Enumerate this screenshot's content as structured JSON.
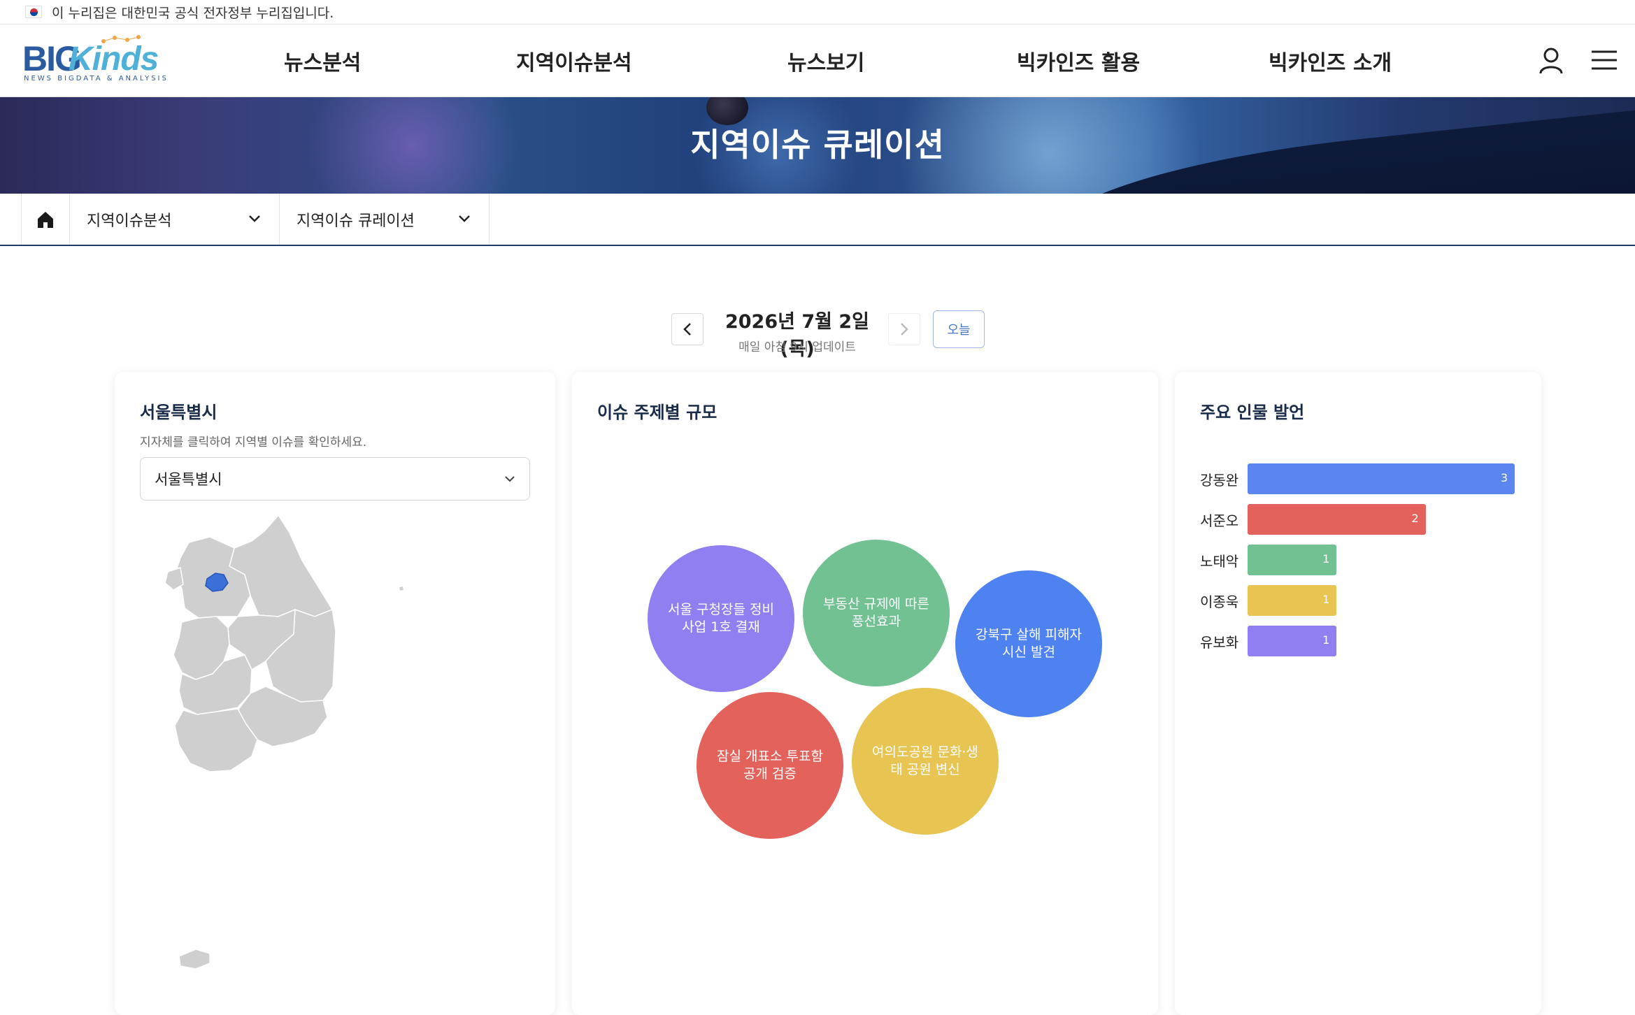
{
  "gov_banner": {
    "text": "이 누리집은 대한민국 공식 전자정부 누리집입니다."
  },
  "logo": {
    "main": "BIG",
    "accent": "Kinds",
    "sub": "NEWS BIGDATA & ANALYSIS"
  },
  "nav": {
    "items": [
      "뉴스분석",
      "지역이슈분석",
      "뉴스보기",
      "빅카인즈 활용",
      "빅카인즈 소개"
    ]
  },
  "hero": {
    "title": "지역이슈 큐레이션"
  },
  "breadcrumb": {
    "level1": "지역이슈분석",
    "level2": "지역이슈 큐레이션"
  },
  "date_nav": {
    "date": "2026년 7월 2일 (목)",
    "note": "매일 아침 9시 업데이트",
    "today_label": "오늘"
  },
  "region_card": {
    "title": "서울특별시",
    "hint": "지자체를 클릭하여 지역별 이슈를 확인하세요.",
    "selected_region": "서울특별시"
  },
  "issue_card": {
    "title": "이슈 주제별 규모",
    "bubbles": [
      {
        "label": "서울 구청장들 정비 사업 1호 결재",
        "color": "#8f7ff0"
      },
      {
        "label": "부동산 규제에 따른 풍선효과",
        "color": "#71c193"
      },
      {
        "label": "강북구 살해 피해자 시신 발견",
        "color": "#4f82f1"
      },
      {
        "label": "잠실 개표소 투표함 공개 검증",
        "color": "#e3635c"
      },
      {
        "label": "여의도공원 문화·생태 공원 변신",
        "color": "#e8c453"
      }
    ]
  },
  "quote_card": {
    "title": "주요 인물 발언",
    "people": [
      {
        "name": "강동완",
        "count": 3,
        "color": "#5b86f0"
      },
      {
        "name": "서준오",
        "count": 2,
        "color": "#e3635c"
      },
      {
        "name": "노태악",
        "count": 1,
        "color": "#71c193"
      },
      {
        "name": "이종욱",
        "count": 1,
        "color": "#e8c453"
      },
      {
        "name": "유보화",
        "count": 1,
        "color": "#8f7ff0"
      }
    ]
  },
  "colors": {
    "brand": "#2c5aa0",
    "accent": "#4fb0d8",
    "highlight": "#3d6fd8",
    "map_gray": "#cfcfcf"
  }
}
